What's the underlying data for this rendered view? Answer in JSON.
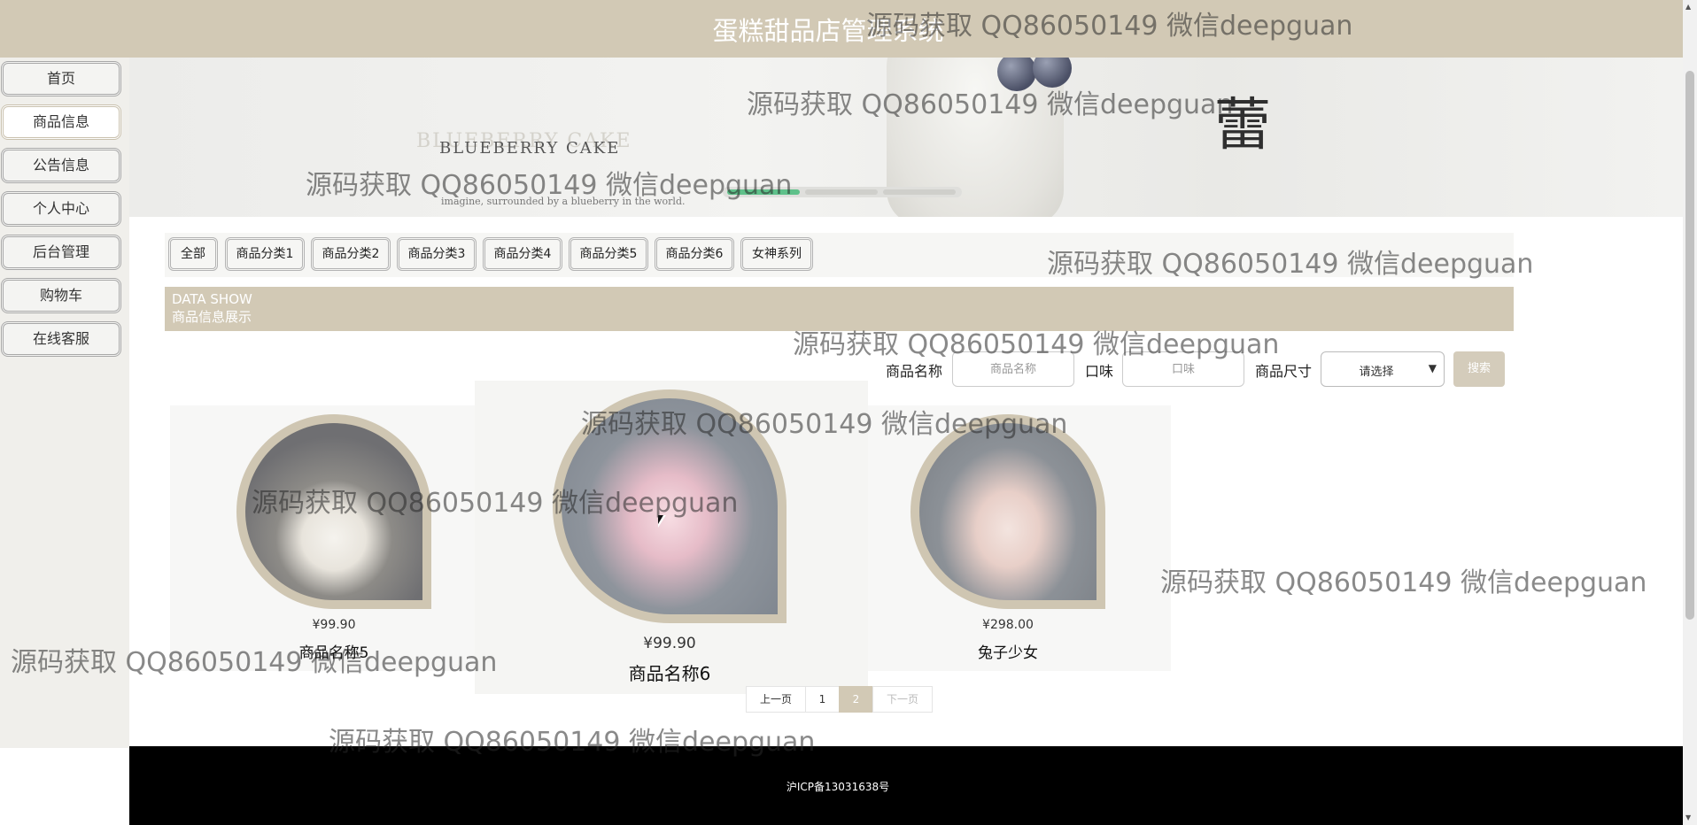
{
  "header": {
    "title": "蛋糕甜品店管理系统"
  },
  "sidebar": {
    "items": [
      {
        "label": "首页"
      },
      {
        "label": "商品信息",
        "active": true
      },
      {
        "label": "公告信息"
      },
      {
        "label": "个人中心"
      },
      {
        "label": "后台管理"
      },
      {
        "label": "购物车"
      },
      {
        "label": "在线客服"
      }
    ]
  },
  "banner": {
    "text_main": "BLUEBERRY  CAKE",
    "text_faded": "BLUEBERRY  CAKE",
    "tagline": "imagine, surrounded by a blueberry in the world.",
    "glyph": "蕾"
  },
  "categories": [
    "全部",
    "商品分类1",
    "商品分类2",
    "商品分类3",
    "商品分类4",
    "商品分类5",
    "商品分类6",
    "女神系列"
  ],
  "section": {
    "title_en": "DATA SHOW",
    "title_cn": "商品信息展示"
  },
  "search": {
    "name_label": "商品名称",
    "name_placeholder": "商品名称",
    "taste_label": "口味",
    "taste_placeholder": "口味",
    "size_label": "商品尺寸",
    "size_value": "请选择",
    "button": "搜索"
  },
  "products": [
    {
      "price": "¥99.90",
      "name": "商品名称5"
    },
    {
      "price": "¥99.90",
      "name": "商品名称6"
    },
    {
      "price": "¥298.00",
      "name": "兔子少女"
    }
  ],
  "pagination": {
    "prev": "上一页",
    "pages": [
      "1",
      "2"
    ],
    "current": "2",
    "next": "下一页"
  },
  "footer": {
    "icp": "沪ICP备13031638号"
  },
  "watermark": "源码获取 QQ86050149 微信deepguan",
  "colors": {
    "accent": "#d2c9b5",
    "footer": "#000000"
  }
}
